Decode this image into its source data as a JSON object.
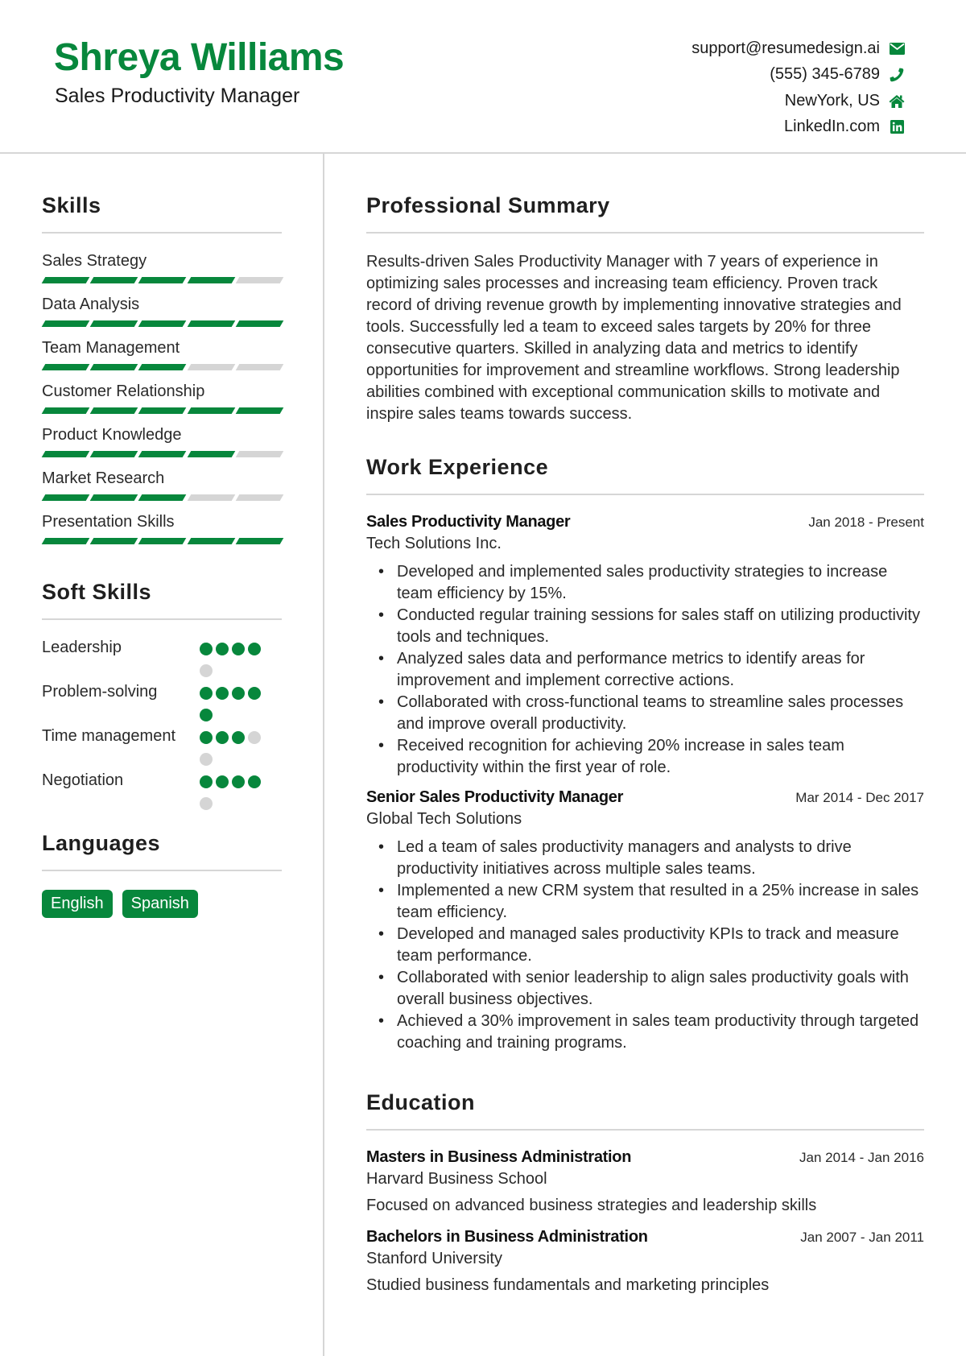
{
  "header": {
    "name": "Shreya Williams",
    "role": "Sales Productivity Manager",
    "contacts": [
      {
        "text": "support@resumedesign.ai",
        "icon": "envelope-icon"
      },
      {
        "text": "(555) 345-6789",
        "icon": "phone-icon"
      },
      {
        "text": "NewYork, US",
        "icon": "home-icon"
      },
      {
        "text": "LinkedIn.com",
        "icon": "linkedin-icon"
      }
    ]
  },
  "colors": {
    "accent": "#07873c",
    "muted": "#d5d5d5",
    "rule": "#d6d6d6"
  },
  "skills": {
    "title": "Skills",
    "max": 5,
    "items": [
      {
        "name": "Sales Strategy",
        "level": 4
      },
      {
        "name": "Data Analysis",
        "level": 5
      },
      {
        "name": "Team Management",
        "level": 3
      },
      {
        "name": "Customer Relationship",
        "level": 5
      },
      {
        "name": "Product Knowledge",
        "level": 4
      },
      {
        "name": "Market Research",
        "level": 3
      },
      {
        "name": "Presentation Skills",
        "level": 5
      }
    ]
  },
  "soft_skills": {
    "title": "Soft Skills",
    "max": 5,
    "items": [
      {
        "name": "Leadership",
        "level": 4
      },
      {
        "name": "Problem-solving",
        "level": 5
      },
      {
        "name": "Time management",
        "level": 3
      },
      {
        "name": "Negotiation",
        "level": 4
      }
    ]
  },
  "languages": {
    "title": "Languages",
    "items": [
      "English",
      "Spanish"
    ]
  },
  "summary": {
    "title": "Professional Summary",
    "text": "Results-driven Sales Productivity Manager with 7 years of experience in optimizing sales processes and increasing team efficiency. Proven track record of driving revenue growth by implementing innovative strategies and tools. Successfully led a team to exceed sales targets by 20% for three consecutive quarters. Skilled in analyzing data and metrics to identify opportunities for improvement and streamline workflows. Strong leadership abilities combined with exceptional communication skills to motivate and inspire sales teams towards success."
  },
  "experience": {
    "title": "Work Experience",
    "jobs": [
      {
        "title": "Sales Productivity Manager",
        "company": "Tech Solutions Inc.",
        "dates": "Jan 2018 - Present",
        "bullets": [
          "Developed and implemented sales productivity strategies to increase team efficiency by 15%.",
          "Conducted regular training sessions for sales staff on utilizing productivity tools and techniques.",
          "Analyzed sales data and performance metrics to identify areas for improvement and implement corrective actions.",
          "Collaborated with cross-functional teams to streamline sales processes and improve overall productivity.",
          "Received recognition for achieving 20% increase in sales team productivity within the first year of role."
        ]
      },
      {
        "title": "Senior Sales Productivity Manager",
        "company": "Global Tech Solutions",
        "dates": "Mar 2014 - Dec 2017",
        "bullets": [
          "Led a team of sales productivity managers and analysts to drive productivity initiatives across multiple sales teams.",
          "Implemented a new CRM system that resulted in a 25% increase in sales team efficiency.",
          "Developed and managed sales productivity KPIs to track and measure team performance.",
          "Collaborated with senior leadership to align sales productivity goals with overall business objectives.",
          "Achieved a 30% improvement in sales team productivity through targeted coaching and training programs."
        ]
      }
    ]
  },
  "education": {
    "title": "Education",
    "items": [
      {
        "degree": "Masters in Business Administration",
        "school": "Harvard Business School",
        "dates": "Jan 2014 - Jan 2016",
        "desc": "Focused on advanced business strategies and leadership skills"
      },
      {
        "degree": "Bachelors in Business Administration",
        "school": "Stanford University",
        "dates": "Jan 2007 - Jan 2011",
        "desc": "Studied business fundamentals and marketing principles"
      }
    ]
  }
}
